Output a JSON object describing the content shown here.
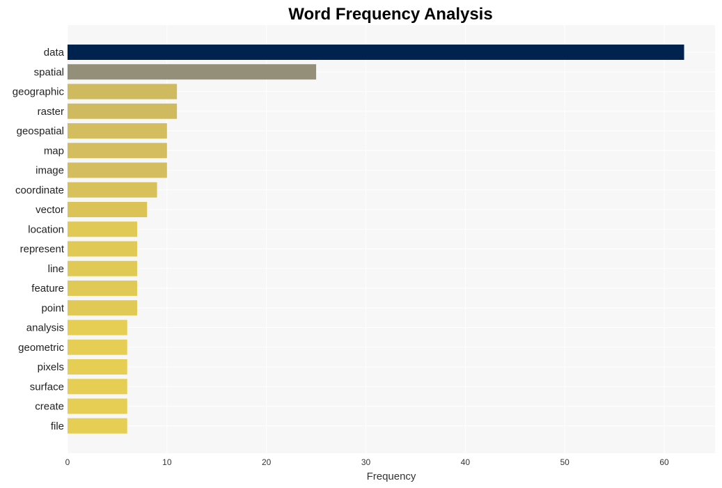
{
  "chart_data": {
    "type": "bar",
    "orientation": "horizontal",
    "title": "Word Frequency Analysis",
    "xlabel": "Frequency",
    "ylabel": "",
    "xlim": [
      0,
      65
    ],
    "xticks": [
      0,
      10,
      20,
      30,
      40,
      50,
      60
    ],
    "grid": true,
    "categories": [
      "data",
      "spatial",
      "geographic",
      "raster",
      "geospatial",
      "map",
      "image",
      "coordinate",
      "vector",
      "location",
      "represent",
      "line",
      "feature",
      "point",
      "analysis",
      "geometric",
      "pixels",
      "surface",
      "create",
      "file"
    ],
    "values": [
      62,
      25,
      11,
      11,
      10,
      10,
      10,
      9,
      8,
      7,
      7,
      7,
      7,
      7,
      6,
      6,
      6,
      6,
      6,
      6
    ],
    "colors": [
      "#00224e",
      "#948f78",
      "#cfba5f",
      "#cfba5f",
      "#d3bd5e",
      "#d3bd5e",
      "#d3bd5e",
      "#d8c15b",
      "#dcc358",
      "#e1c956",
      "#e1c956",
      "#e1c956",
      "#e1c956",
      "#e1c956",
      "#e5ce53",
      "#e5ce53",
      "#e5ce53",
      "#e5ce53",
      "#e5ce53",
      "#e5ce53"
    ]
  }
}
